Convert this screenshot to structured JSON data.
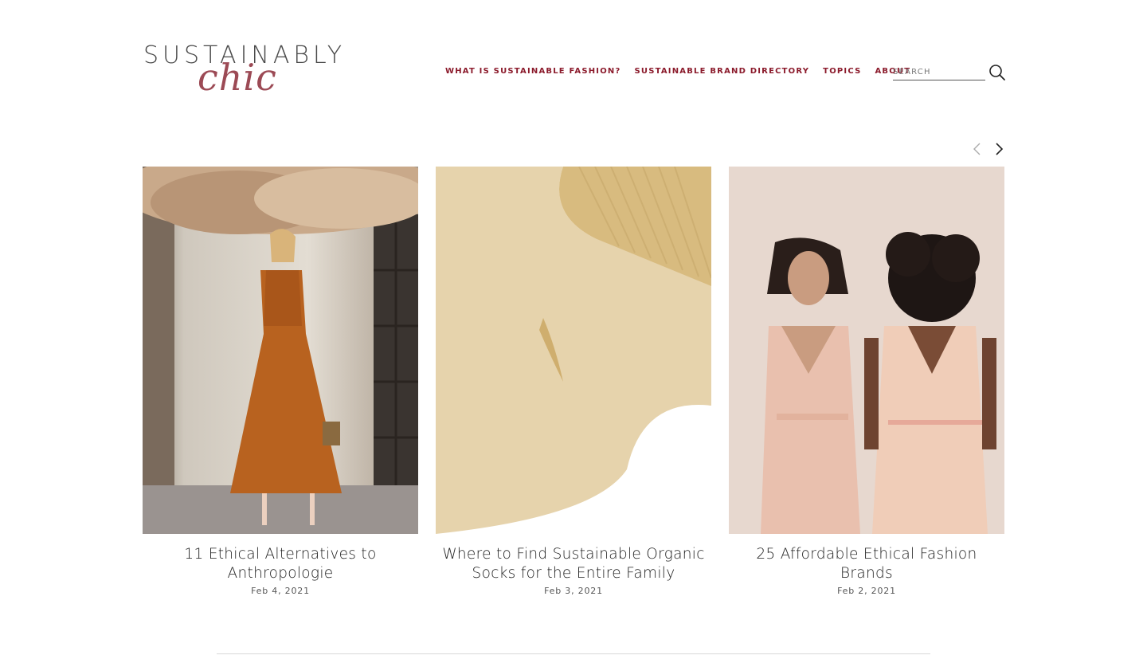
{
  "brand": {
    "top": "SUSTAINABLY",
    "script": "chic"
  },
  "nav": [
    {
      "label": "WHAT IS SUSTAINABLE FASHION?"
    },
    {
      "label": "SUSTAINABLE BRAND DIRECTORY"
    },
    {
      "label": "TOPICS"
    },
    {
      "label": "ABOUT"
    }
  ],
  "search": {
    "placeholder": "SEARCH",
    "icon": "search-icon"
  },
  "carousel": {
    "prev_icon": "chevron-left-icon",
    "next_icon": "chevron-right-icon",
    "posts": [
      {
        "title": "11 Ethical Alternatives to Anthropologie",
        "date": "Feb 4, 2021"
      },
      {
        "title": "Where to Find Sustainable Organic Socks for the Entire Family",
        "date": "Feb 3, 2021"
      },
      {
        "title": "25 Affordable Ethical Fashion Brands",
        "date": "Feb 2, 2021"
      }
    ]
  },
  "colors": {
    "accent": "#8b1a2b",
    "logo_script": "#9c4a55",
    "text": "#1e1e1e"
  }
}
